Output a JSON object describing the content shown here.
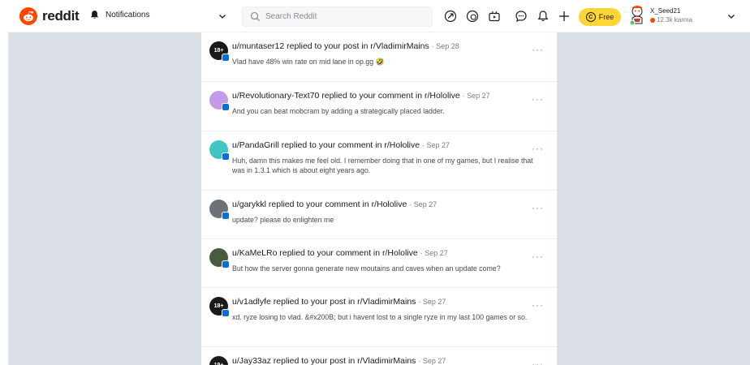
{
  "header": {
    "logo_text": "reddit",
    "page_label": "Notifications",
    "search_placeholder": "Search Reddit",
    "free_label": "Free",
    "free_coin_glyph": "C",
    "user": {
      "name": "X_Seed21",
      "karma": "12.3k karma"
    },
    "icons": [
      "popular-icon",
      "coins-icon",
      "video-icon",
      "chat-icon",
      "bell-icon",
      "plus-icon"
    ]
  },
  "notifications": [
    {
      "title": "u/muntaser12 replied to your post in r/VladimirMains",
      "date": "· Sep 28",
      "body": "Vlad have 48% win rate on mid lane in op.gg 🤣",
      "avatar_color": "#1a1a1b",
      "avatar_text": "18+"
    },
    {
      "title": "u/Revolutionary-Text70 replied to your comment in r/Hololive",
      "date": "· Sep 27",
      "body": "And you can beat mobcram by adding a strategically placed ladder.",
      "avatar_color": "#c39ae8",
      "avatar_text": ""
    },
    {
      "title": "u/PandaGrill replied to your comment in r/Hololive",
      "date": "· Sep 27",
      "body": "Huh, damn this makes me feel old. I remember doing that in one of my games, but I realise that was in 1.3.1 which is about eight years ago.",
      "avatar_color": "#3fc6c4",
      "avatar_text": ""
    },
    {
      "title": "u/garykkl replied to your comment in r/Hololive",
      "date": "· Sep 27",
      "body": "update? please do enlighten me",
      "avatar_color": "#6c7378",
      "avatar_text": ""
    },
    {
      "title": "u/KaMeLRo replied to your comment in r/Hololive",
      "date": "· Sep 27",
      "body": "But how the server gonna generate new moutains and caves when an update come?",
      "avatar_color": "#4a5a3e",
      "avatar_text": ""
    },
    {
      "title": "u/v1adlyfe replied to your post in r/VladimirMains",
      "date": "· Sep 27",
      "body": "xd. ryze losing to vlad. &#x200B; but i havent lost to a single ryze in my last 100 games or so.",
      "avatar_color": "#1a1a1b",
      "avatar_text": "18+"
    },
    {
      "title": "u/Jay33az replied to your post in r/VladimirMains",
      "date": "· Sep 27",
      "body": "",
      "avatar_color": "#1a1a1b",
      "avatar_text": "18+"
    }
  ],
  "more_glyph": "···"
}
